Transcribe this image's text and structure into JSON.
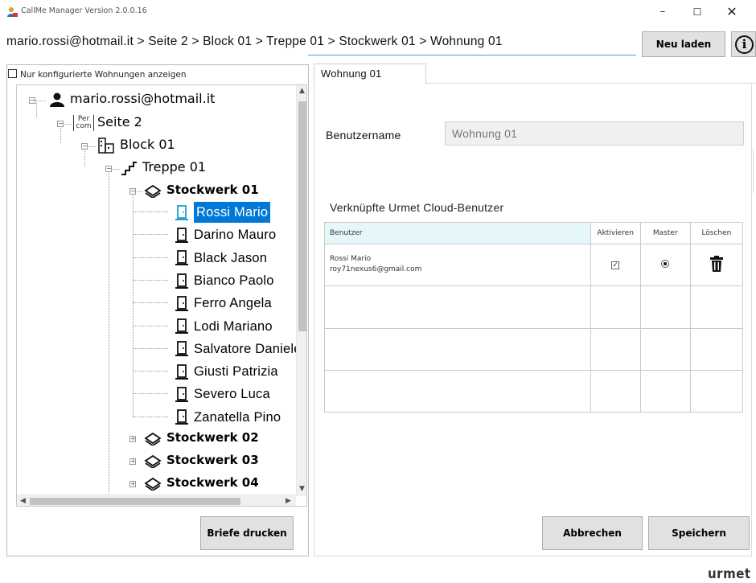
{
  "window": {
    "title": "CallMe Manager Version 2.0.0.16",
    "minimize": "–",
    "maximize": "☐",
    "close": "✕"
  },
  "header": {
    "breadcrumb": "mario.rossi@hotmail.it  > Seite 2 > Block 01 > Treppe 01 > Stockwerk 01 > Wohnung 01",
    "reload_label": "Neu laden",
    "info_label": "i"
  },
  "sidebar": {
    "filter_label": "Nur konfigurierte Wohnungen anzeigen",
    "tree": {
      "user": "mario.rossi@hotmail.it",
      "page": "Seite 2",
      "page_icon": "Per com",
      "block": "Block 01",
      "stair": "Treppe 01",
      "floor": "Stockwerk 01",
      "apartments": [
        "Rossi Mario",
        "Darino Mauro",
        "Black Jason",
        "Bianco Paolo",
        "Ferro Angela",
        "Lodi Mariano",
        "Salvatore Daniele",
        "Giusti Patrizia",
        "Severo Luca",
        "Zanatella Pino"
      ],
      "other_floors": [
        "Stockwerk 02",
        "Stockwerk 03",
        "Stockwerk 04"
      ]
    },
    "print_label": "Briefe drucken"
  },
  "main": {
    "tab_label": "Wohnung 01",
    "username_label": "Benutzername",
    "username_value": "Wohnung 01",
    "linked_title": "Verknüpfte Urmet Cloud-Benutzer",
    "columns": [
      "Benutzer",
      "Aktivieren",
      "Master",
      "Löschen"
    ],
    "rows": [
      {
        "name": "Rossi Mario",
        "email": "roy71nexus6@gmail.com",
        "active": true,
        "master": true
      }
    ],
    "cancel_label": "Abbrechen",
    "save_label": "Speichern"
  },
  "footer": {
    "logo": "urmet"
  },
  "colors": {
    "selection": "#0078d7",
    "accent_line": "#3aa3d9",
    "header_highlight": "#e6f7fc"
  }
}
